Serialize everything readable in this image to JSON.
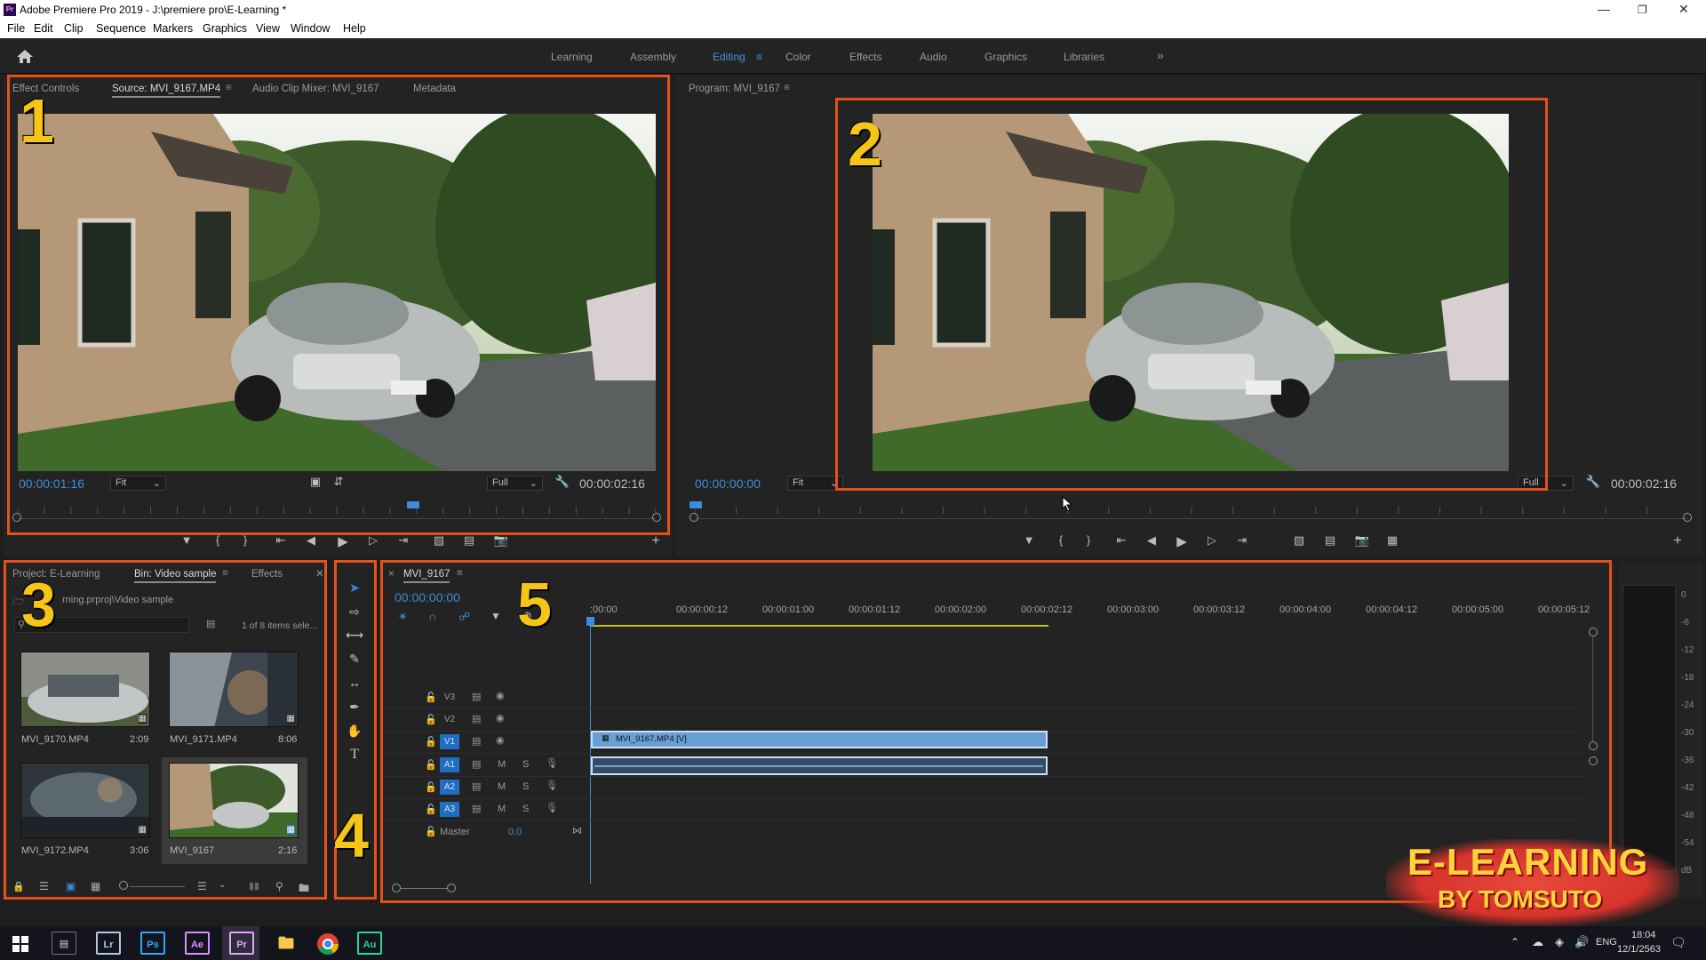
{
  "window": {
    "title": "Adobe Premiere Pro 2019 - J:\\premiere pro\\E-Learning *",
    "app_badge": "Pr"
  },
  "menu": [
    "File",
    "Edit",
    "Clip",
    "Sequence",
    "Markers",
    "Graphics",
    "View",
    "Window",
    "Help"
  ],
  "workspaces": [
    "Learning",
    "Assembly",
    "Editing",
    "Color",
    "Effects",
    "Audio",
    "Graphics",
    "Libraries"
  ],
  "workspace_active": "Editing",
  "source": {
    "tabs": [
      "Effect Controls",
      "Source: MVI_9167.MP4",
      "Audio Clip Mixer: MVI_9167",
      "Metadata"
    ],
    "timecode": "00:00:01:16",
    "zoom": "Fit",
    "quality": "Full",
    "duration": "00:00:02:16",
    "playhead_fraction": 0.62
  },
  "program": {
    "tab": "Program: MVI_9167",
    "timecode": "00:00:00:00",
    "zoom": "Fit",
    "quality": "Full",
    "duration": "00:00:02:16"
  },
  "project": {
    "tabs": [
      "Project: E-Learning",
      "Bin: Video sample",
      "Effects"
    ],
    "path": "rning.prproj\\Video sample",
    "count": "1 of 8 items sele...",
    "items": [
      {
        "name": "MVI_9170.MP4",
        "duration": "2:09"
      },
      {
        "name": "MVI_9171.MP4",
        "duration": "8:06"
      },
      {
        "name": "MVI_9172.MP4",
        "duration": "3:06"
      },
      {
        "name": "MVI_9167",
        "duration": "2:16"
      }
    ]
  },
  "timeline": {
    "tab": "MVI_9167",
    "timecode": "00:00:00:00",
    "ticks": [
      ":00:00",
      "00:00:00:12",
      "00:00:01:00",
      "00:00:01:12",
      "00:00:02:00",
      "00:00:02:12",
      "00:00:03:00",
      "00:00:03:12",
      "00:00:04:00",
      "00:00:04:12",
      "00:00:05:00",
      "00:00:05:12"
    ],
    "video_tracks": [
      "V3",
      "V2",
      "V1"
    ],
    "audio_tracks": [
      "A1",
      "A2",
      "A3"
    ],
    "master_label": "Master",
    "master_value": "0.0",
    "clip_label": "MVI_9167.MP4 [V]",
    "track_buttons": {
      "mute": "M",
      "solo": "S"
    }
  },
  "meter_scale": [
    "0",
    "-6",
    "-12",
    "-18",
    "-24",
    "-30",
    "-36",
    "-42",
    "-48",
    "-54",
    "dB"
  ],
  "overlay_numbers": [
    "1",
    "2",
    "3",
    "4",
    "5"
  ],
  "watermark": {
    "line1": "E-LEARNING",
    "line2": "BY TOMSUTO"
  },
  "taskbar": {
    "apps": [
      "Lr",
      "Ps",
      "Ae",
      "Pr",
      "Au"
    ],
    "lang": "ENG",
    "time": "18:04",
    "date": "12/1/2563"
  }
}
